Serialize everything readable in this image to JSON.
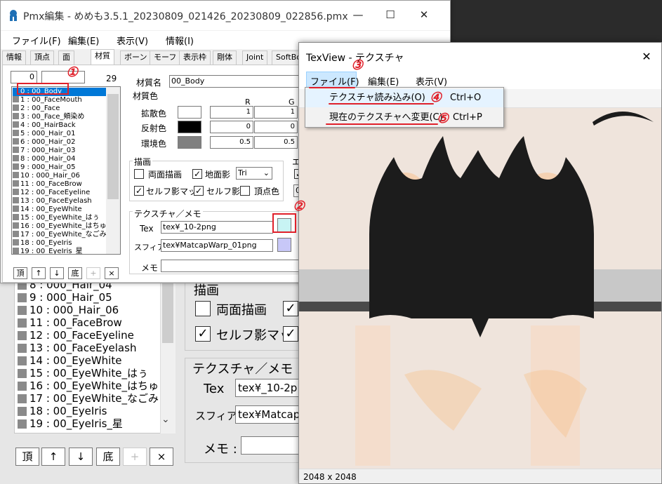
{
  "pmx_window": {
    "title": "Pmx編集 - めめも3.5.1_20230809_021426_20230809_022856.pmx",
    "controls": {
      "minimize": "—",
      "maximize": "☐",
      "close": "✕"
    },
    "menu": [
      "ファイル(F)",
      "編集(E)",
      "表示(V)",
      "情報(I)"
    ],
    "tabs": [
      "情報",
      "頂点",
      "面",
      "材質",
      "ボーン",
      "モーフ",
      "表示枠",
      "剛体",
      "Joint",
      "SoftBo"
    ],
    "index_value": "0",
    "count_value": "29",
    "materials": [
      "0 : 00_Body",
      "1 : 00_FaceMouth",
      "2 : 00_Face",
      "3 : 00_Face_頬染め",
      "4 : 00_HairBack",
      "5 : 000_Hair_01",
      "6 : 000_Hair_02",
      "7 : 000_Hair_03",
      "8 : 000_Hair_04",
      "9 : 000_Hair_05",
      "10 : 000_Hair_06",
      "11 : 00_FaceBrow",
      "12 : 00_FaceEyeline",
      "13 : 00_FaceEyelash",
      "14 : 00_EyeWhite",
      "15 : 00_EyeWhite_はぅ",
      "16 : 00_EyeWhite_はちゅ",
      "17 : 00_EyeWhite_なごみ",
      "18 : 00_EyeIris",
      "19 : 00_EyeIris_星"
    ],
    "list_buttons": [
      "頂",
      "↑",
      "↓",
      "底",
      "+",
      "×"
    ],
    "material_name_label": "材質名",
    "material_name_value": "00_Body",
    "material_color_label": "材質色",
    "col_r": "R",
    "col_g": "G",
    "diffuse_label": "拡散色",
    "specular_label": "反射色",
    "ambient_label": "環境色",
    "diffuse_r": "1",
    "diffuse_g": "1",
    "specular_r": "0",
    "specular_g": "0",
    "ambient_r": "0.5",
    "ambient_g": "0.5",
    "draw_label": "描画",
    "double_sided": "両面描画",
    "ground_shadow": "地面影",
    "primitive": "Tri",
    "self_shadow_map": "セルフ影マッ",
    "self_shadow": "セルフ影",
    "vertex_color": "頂点色",
    "edge_label_partial": "エ",
    "edge_value_partial": "0",
    "texture_group_label": "テクスチャ／メモ",
    "tex_label": "Tex",
    "tex_value": "tex¥_10-2png",
    "sphere_label": "スフィア",
    "sphere_value": "tex¥MatcapWarp_01png",
    "memo_label": "メモ :"
  },
  "background": {
    "materials": [
      "8 : 000_Hair_04",
      "9 : 000_Hair_05",
      "10 : 000_Hair_06",
      "11 : 00_FaceBrow",
      "12 : 00_FaceEyeline",
      "13 : 00_FaceEyelash",
      "14 : 00_EyeWhite",
      "15 : 00_EyeWhite_はぅ",
      "16 : 00_EyeWhite_はちゅ",
      "17 : 00_EyeWhite_なごみ",
      "18 : 00_EyeIris",
      "19 : 00_EyeIris_星"
    ],
    "draw_label": "描画",
    "double_sided": "両面描画",
    "self_shadow_map": "セルフ影マッ",
    "texture_group_label": "テクスチャ／メモ",
    "tex_label": "Tex",
    "tex_value": "tex¥_10-2p",
    "sphere_label": "スフィア",
    "sphere_value": "tex¥Matcap",
    "memo_label": "メモ :"
  },
  "texview": {
    "title": "TexView - テクスチャ",
    "close": "✕",
    "menu": [
      "ファイル(F)",
      "編集(E)",
      "表示(V)"
    ],
    "dropdown": [
      {
        "label": "テクスチャ読み込み(O)",
        "shortcut": "Ctrl+O"
      },
      {
        "label": "現在のテクスチャへ変更(C)",
        "shortcut": "Ctrl+P"
      }
    ],
    "status": "2048 x 2048"
  },
  "annotations": [
    "①",
    "②",
    "③",
    "④",
    "⑤"
  ],
  "colors": {
    "annotation": "#e0202a",
    "selection": "#0078d7",
    "sphere_swatch": "#c8c8f8",
    "tex_swatch": "#c8f4f4"
  }
}
